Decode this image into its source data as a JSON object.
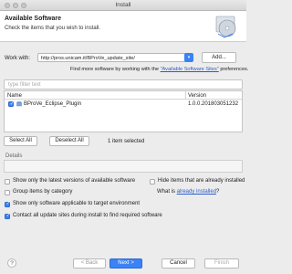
{
  "window": {
    "title": "Install"
  },
  "header": {
    "title": "Available Software",
    "subtitle": "Check the items that you wish to install.",
    "icon": "install-disc-icon"
  },
  "workwith": {
    "label": "Work with:",
    "value": "http://pros.unicam.it/BProVe_update_site/",
    "add_label": "Add...",
    "findmore_prefix": "Find more software by working with the ",
    "findmore_link": "\"Available Software Sites\"",
    "findmore_suffix": " preferences."
  },
  "filter": {
    "placeholder": "type filter text"
  },
  "table": {
    "col_name": "Name",
    "col_version": "Version",
    "rows": [
      {
        "name": "BProVe_Eclipse_Plugin",
        "version": "1.0.0.201803051232",
        "checked": true
      }
    ]
  },
  "selection": {
    "select_all": "Select All",
    "deselect_all": "Deselect All",
    "count": "1 item selected"
  },
  "details": {
    "label": "Details"
  },
  "options": {
    "latest_only": "Show only the latest versions of available software",
    "hide_installed": "Hide items that are already installed",
    "group_by_category": "Group items by category",
    "what_is_prefix": "What is ",
    "what_is_link": "already installed",
    "what_is_suffix": "?",
    "applicable_only": "Show only software applicable to target environment",
    "contact_sites": "Contact all update sites during install to find required software"
  },
  "footer": {
    "help": "?",
    "back": "< Back",
    "next": "Next >",
    "cancel": "Cancel",
    "finish": "Finish"
  },
  "colors": {
    "accent": "#3b82f6",
    "link": "#2a5dc8"
  }
}
